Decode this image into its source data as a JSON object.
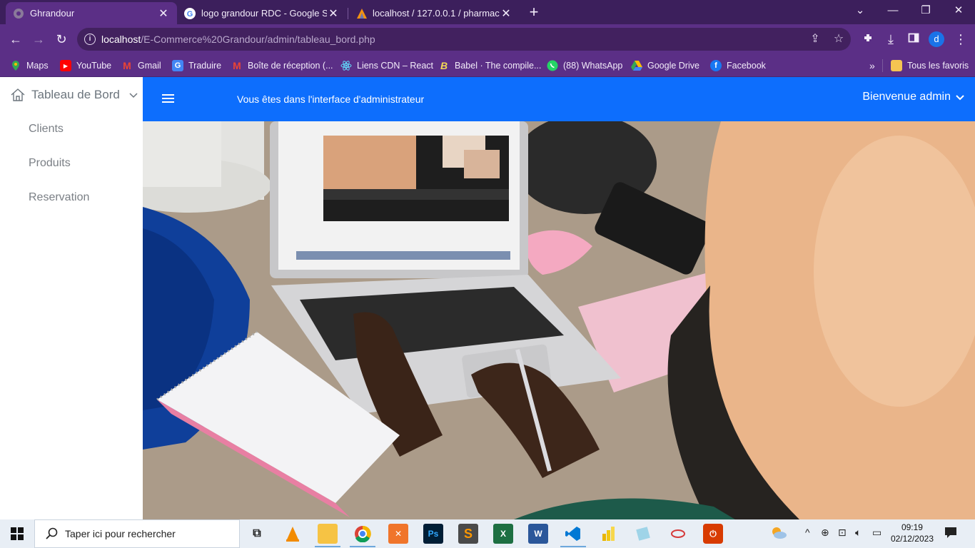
{
  "browser": {
    "tabs": [
      {
        "title": "Ghrandour",
        "active": true
      },
      {
        "title": "logo grandour RDC - Google Se",
        "active": false
      },
      {
        "title": "localhost / 127.0.0.1 / pharmacie",
        "active": false
      }
    ],
    "url_host": "localhost",
    "url_path": "/E-Commerce%20Grandour/admin/tableau_bord.php",
    "profile_letter": "d",
    "bookmarks": [
      {
        "label": "Maps"
      },
      {
        "label": "YouTube"
      },
      {
        "label": "Gmail"
      },
      {
        "label": "Traduire"
      },
      {
        "label": "Boîte de réception (..."
      },
      {
        "label": "Liens CDN – React"
      },
      {
        "label": "Babel · The compile..."
      },
      {
        "label": "(88) WhatsApp"
      },
      {
        "label": "Google Drive"
      },
      {
        "label": "Facebook"
      }
    ],
    "all_bookmarks": "Tous les favoris"
  },
  "sidebar": {
    "title": "Tableau de Bord",
    "items": [
      {
        "label": "Clients"
      },
      {
        "label": "Produits"
      },
      {
        "label": "Reservation"
      }
    ]
  },
  "navbar": {
    "message": "Vous êtes dans l'interface d'administrateur",
    "user_menu": "Bienvenue admin",
    "color": "#0d6efd"
  },
  "taskbar": {
    "search_placeholder": "Taper ici pour rechercher",
    "time": "09:19",
    "date": "02/12/2023"
  }
}
